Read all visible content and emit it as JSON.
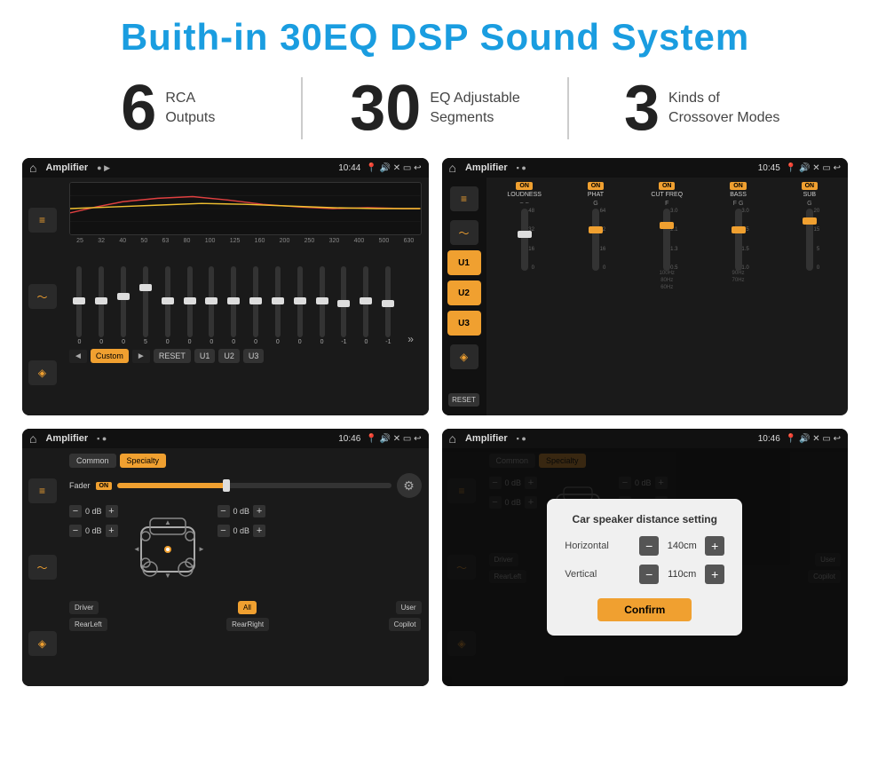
{
  "page": {
    "title": "Buith-in 30EQ DSP Sound System",
    "stats": [
      {
        "number": "6",
        "desc_line1": "RCA",
        "desc_line2": "Outputs"
      },
      {
        "number": "30",
        "desc_line1": "EQ Adjustable",
        "desc_line2": "Segments"
      },
      {
        "number": "3",
        "desc_line1": "Kinds of",
        "desc_line2": "Crossover Modes"
      }
    ]
  },
  "screen1": {
    "status_bar": {
      "app_title": "Amplifier",
      "time": "10:44"
    },
    "eq_labels": [
      "25",
      "32",
      "40",
      "50",
      "63",
      "80",
      "100",
      "125",
      "160",
      "200",
      "250",
      "320",
      "400",
      "500",
      "630"
    ],
    "slider_values": [
      "0",
      "0",
      "0",
      "5",
      "0",
      "0",
      "0",
      "0",
      "0",
      "0",
      "0",
      "0",
      "-1",
      "0",
      "-1"
    ],
    "buttons": {
      "prev": "◄",
      "label": "Custom",
      "next": "►",
      "reset": "RESET",
      "u1": "U1",
      "u2": "U2",
      "u3": "U3"
    }
  },
  "screen2": {
    "status_bar": {
      "app_title": "Amplifier",
      "time": "10:45"
    },
    "presets": [
      "U1",
      "U2",
      "U3"
    ],
    "channels": [
      {
        "label": "LOUDNESS",
        "on": true
      },
      {
        "label": "PHAT",
        "on": true
      },
      {
        "label": "CUT FREQ",
        "on": true
      },
      {
        "label": "BASS",
        "on": true
      },
      {
        "label": "SUB",
        "on": true
      }
    ],
    "reset_label": "RESET"
  },
  "screen3": {
    "status_bar": {
      "app_title": "Amplifier",
      "time": "10:46"
    },
    "tabs": [
      "Common",
      "Specialty"
    ],
    "fader_label": "Fader",
    "fader_on": "ON",
    "vol_rows": [
      {
        "val": "0 dB"
      },
      {
        "val": "0 dB"
      },
      {
        "val": "0 dB"
      },
      {
        "val": "0 dB"
      }
    ],
    "bottom_btns": [
      "Driver",
      "RearLeft",
      "All",
      "User",
      "RearRight",
      "Copilot"
    ]
  },
  "screen4": {
    "status_bar": {
      "app_title": "Amplifier",
      "time": "10:46"
    },
    "tabs": [
      "Common",
      "Specialty"
    ],
    "dialog": {
      "title": "Car speaker distance setting",
      "horizontal_label": "Horizontal",
      "horizontal_value": "140cm",
      "vertical_label": "Vertical",
      "vertical_value": "110cm",
      "confirm_label": "Confirm"
    }
  }
}
